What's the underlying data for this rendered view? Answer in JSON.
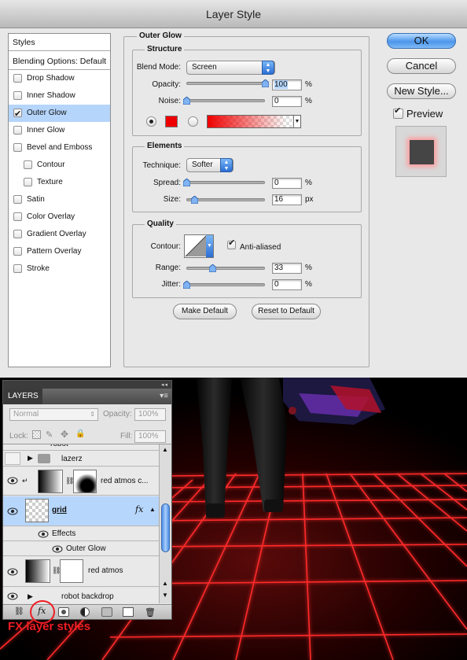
{
  "dialog": {
    "title": "Layer Style",
    "styles_header": "Styles",
    "blending_options": "Blending Options: Default",
    "style_items": [
      {
        "label": "Drop Shadow",
        "checked": false,
        "indent": false
      },
      {
        "label": "Inner Shadow",
        "checked": false,
        "indent": false
      },
      {
        "label": "Outer Glow",
        "checked": true,
        "indent": false
      },
      {
        "label": "Inner Glow",
        "checked": false,
        "indent": false
      },
      {
        "label": "Bevel and Emboss",
        "checked": false,
        "indent": false
      },
      {
        "label": "Contour",
        "checked": false,
        "indent": true
      },
      {
        "label": "Texture",
        "checked": false,
        "indent": true
      },
      {
        "label": "Satin",
        "checked": false,
        "indent": false
      },
      {
        "label": "Color Overlay",
        "checked": false,
        "indent": false
      },
      {
        "label": "Gradient Overlay",
        "checked": false,
        "indent": false
      },
      {
        "label": "Pattern Overlay",
        "checked": false,
        "indent": false
      },
      {
        "label": "Stroke",
        "checked": false,
        "indent": false
      }
    ],
    "outer_glow": {
      "title": "Outer Glow",
      "structure": {
        "title": "Structure",
        "blend_mode_label": "Blend Mode:",
        "blend_mode_value": "Screen",
        "opacity_label": "Opacity:",
        "opacity_value": "100",
        "opacity_unit": "%",
        "opacity_level": 1.0,
        "noise_label": "Noise:",
        "noise_value": "0",
        "noise_unit": "%",
        "noise_level": 0.0,
        "glow_color": "#ee0000"
      },
      "elements": {
        "title": "Elements",
        "technique_label": "Technique:",
        "technique_value": "Softer",
        "spread_label": "Spread:",
        "spread_value": "0",
        "spread_unit": "%",
        "spread_level": 0.0,
        "size_label": "Size:",
        "size_value": "16",
        "size_unit": "px",
        "size_level": 0.1
      },
      "quality": {
        "title": "Quality",
        "contour_label": "Contour:",
        "anti_aliased_label": "Anti-aliased",
        "anti_aliased": true,
        "range_label": "Range:",
        "range_value": "33",
        "range_unit": "%",
        "range_level": 0.33,
        "jitter_label": "Jitter:",
        "jitter_value": "0",
        "jitter_unit": "%",
        "jitter_level": 0.0
      },
      "make_default": "Make Default",
      "reset_default": "Reset to Default"
    },
    "buttons": {
      "ok": "OK",
      "cancel": "Cancel",
      "new_style": "New Style..."
    },
    "preview_label": "Preview",
    "preview_checked": true
  },
  "layers_panel": {
    "tab": "LAYERS",
    "blend_mode": "Normal",
    "opacity_label": "Opacity:",
    "opacity_value": "100%",
    "lock_label": "Lock:",
    "fill_label": "Fill:",
    "fill_value": "100%",
    "layers": [
      {
        "name": "robot",
        "type": "group"
      },
      {
        "name": "lazerz",
        "type": "group"
      },
      {
        "name": "red atmos c...",
        "type": "layer"
      },
      {
        "name": "grid",
        "type": "layer",
        "selected": true
      },
      {
        "name": "Effects",
        "type": "effects"
      },
      {
        "name": "Outer Glow",
        "type": "effect"
      },
      {
        "name": "red atmos",
        "type": "layer"
      },
      {
        "name": "robot backdrop",
        "type": "group"
      }
    ],
    "fx_badge": "fx"
  },
  "caption": "FX layer styles",
  "colors": {
    "accent": "#ee1c24",
    "grid_line": "#ff1a1a",
    "selection": "#b7d6fb"
  }
}
